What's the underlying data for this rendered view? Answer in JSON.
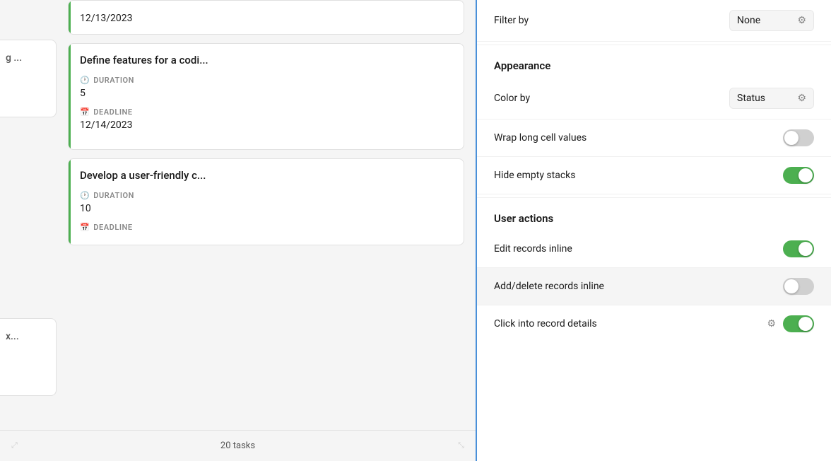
{
  "left_panel": {
    "truncated_col": {
      "items": [
        {
          "text": "g ..."
        },
        {
          "text": "x..."
        }
      ]
    },
    "cards": [
      {
        "title": "Define features for a codi...",
        "duration_label": "DURATION",
        "duration_value": "5",
        "deadline_label": "DEADLINE",
        "deadline_value": "12/14/2023"
      },
      {
        "title": "Develop a user-friendly c...",
        "duration_label": "DURATION",
        "duration_value": "10",
        "deadline_label": "DEADLINE",
        "deadline_value": ""
      }
    ],
    "top_date": "12/13/2023",
    "bottom_bar": {
      "task_count": "20 tasks"
    }
  },
  "right_panel": {
    "filter_section": {
      "filter_by_label": "Filter by",
      "filter_by_value": "None"
    },
    "appearance_section": {
      "title": "Appearance",
      "color_by_label": "Color by",
      "color_by_value": "Status",
      "wrap_label": "Wrap long cell values",
      "wrap_on": false,
      "hide_empty_label": "Hide empty stacks",
      "hide_empty_on": true
    },
    "user_actions_section": {
      "title": "User actions",
      "edit_records_label": "Edit records inline",
      "edit_records_on": true,
      "add_delete_label": "Add/delete records inline",
      "add_delete_on": false,
      "click_into_label": "Click into record details",
      "click_into_on": true
    }
  }
}
